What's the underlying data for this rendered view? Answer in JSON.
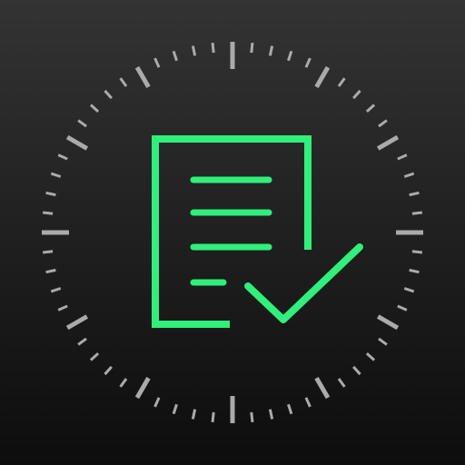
{
  "icon": {
    "name": "checklist-clock-app-icon",
    "background_top": "#333333",
    "background_bottom": "#0d0d0d",
    "accent_color": "#2ef07a",
    "tick_color": "#aaaaaa",
    "dial_tick_count": 60,
    "glyphs": [
      "clock-dial-icon",
      "document-icon",
      "checkmark-icon"
    ]
  }
}
